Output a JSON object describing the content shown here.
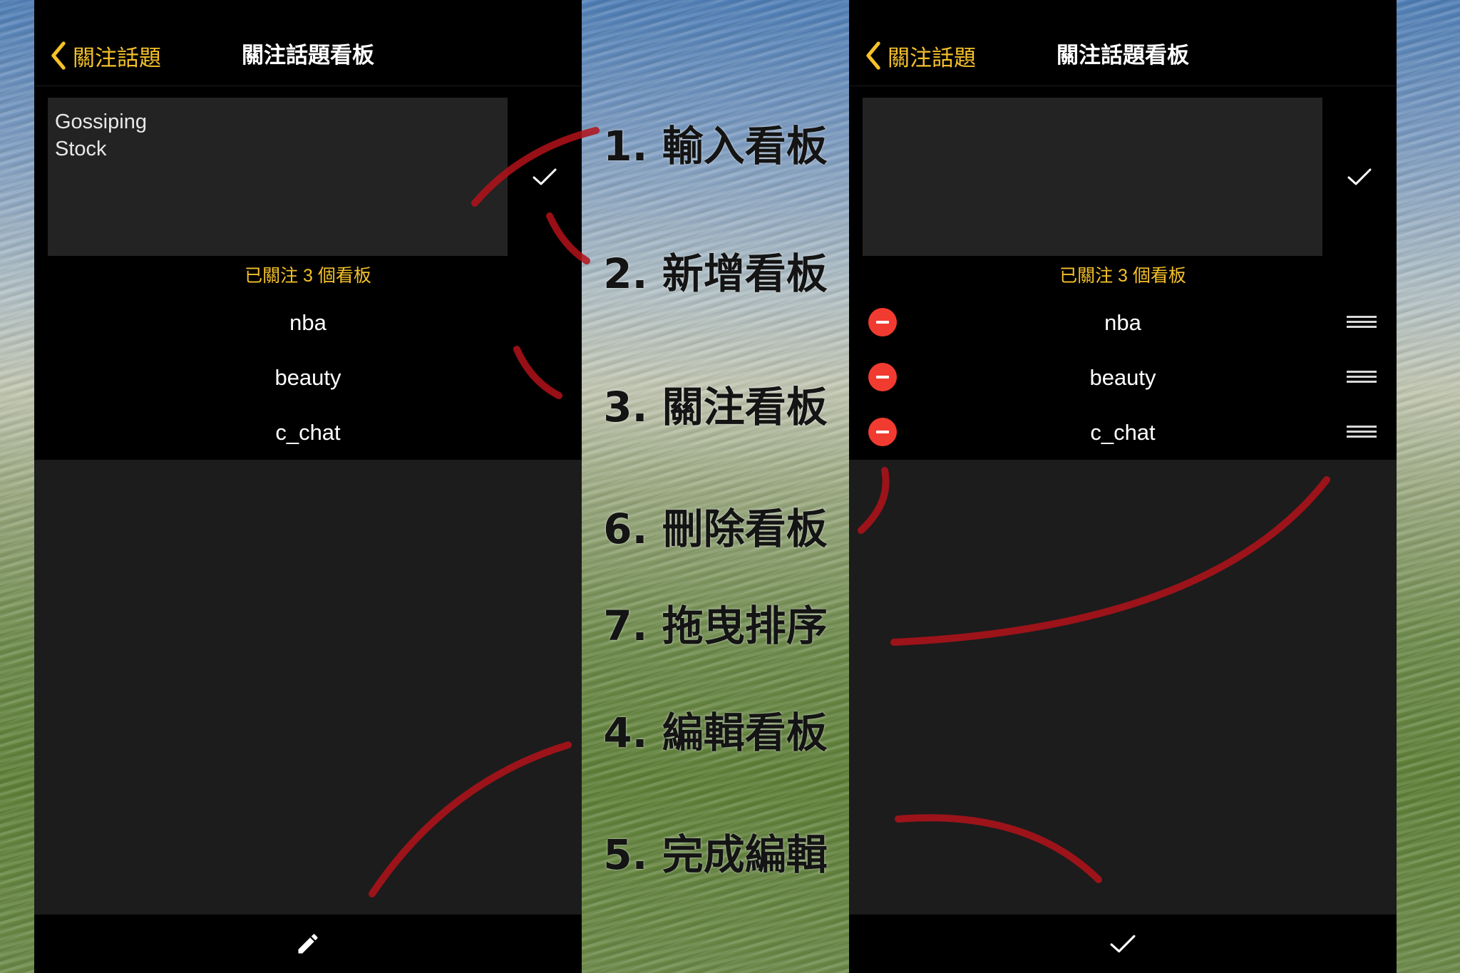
{
  "screens": {
    "left": {
      "nav": {
        "back_label": "關注話題",
        "title": "關注話題看板",
        "back_icon": "chevron-left-icon"
      },
      "input": {
        "value": "Gossiping\nStock"
      },
      "confirm_icon": "checkmark-icon",
      "status": "已關注 3 個看板",
      "boards": [
        "nba",
        "beauty",
        "c_chat"
      ],
      "toolbar_icon": "pencil-icon"
    },
    "right": {
      "nav": {
        "back_label": "關注話題",
        "title": "關注話題看板",
        "back_icon": "chevron-left-icon"
      },
      "input": {
        "value": ""
      },
      "confirm_icon": "checkmark-icon",
      "status": "已關注 3 個看板",
      "boards": [
        "nba",
        "beauty",
        "c_chat"
      ],
      "row_icons": {
        "delete": "minus-circle-icon",
        "reorder": "drag-handle-icon"
      },
      "toolbar_icon": "checkmark-icon"
    }
  },
  "steps": [
    "1. 輸入看板",
    "2. 新增看板",
    "3. 關注看板",
    "6. 刪除看板",
    "7. 拖曳排序",
    "4. 編輯看板",
    "5. 完成編輯"
  ],
  "colors": {
    "accent": "#f5c12a",
    "delete": "#f23b30",
    "annotation": "#b3121a",
    "panel_background": "#000000",
    "input_background": "#232323",
    "empty_area": "#1c1c1c"
  }
}
